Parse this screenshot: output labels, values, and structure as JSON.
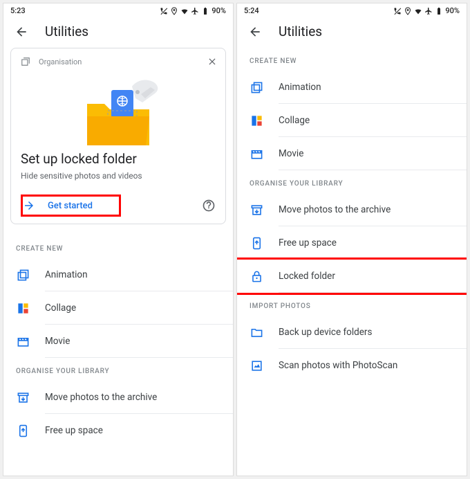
{
  "left": {
    "status": {
      "time": "5:23",
      "battery": "90%"
    },
    "app_title": "Utilities",
    "card": {
      "category": "Organisation",
      "title": "Set up locked folder",
      "subtitle": "Hide sensitive photos and videos",
      "cta": "Get started"
    },
    "sections": {
      "create_new": {
        "header": "CREATE NEW",
        "items": [
          "Animation",
          "Collage",
          "Movie"
        ]
      },
      "organise": {
        "header": "ORGANISE YOUR LIBRARY",
        "items": [
          "Move photos to the archive",
          "Free up space"
        ]
      }
    }
  },
  "right": {
    "status": {
      "time": "5:24",
      "battery": "90%"
    },
    "app_title": "Utilities",
    "sections": {
      "create_new": {
        "header": "CREATE NEW",
        "items": [
          "Animation",
          "Collage",
          "Movie"
        ]
      },
      "organise": {
        "header": "ORGANISE YOUR LIBRARY",
        "items": [
          "Move photos to the archive",
          "Free up space",
          "Locked folder"
        ]
      },
      "import": {
        "header": "IMPORT PHOTOS",
        "items": [
          "Back up device folders",
          "Scan photos with PhotoScan"
        ]
      }
    }
  }
}
